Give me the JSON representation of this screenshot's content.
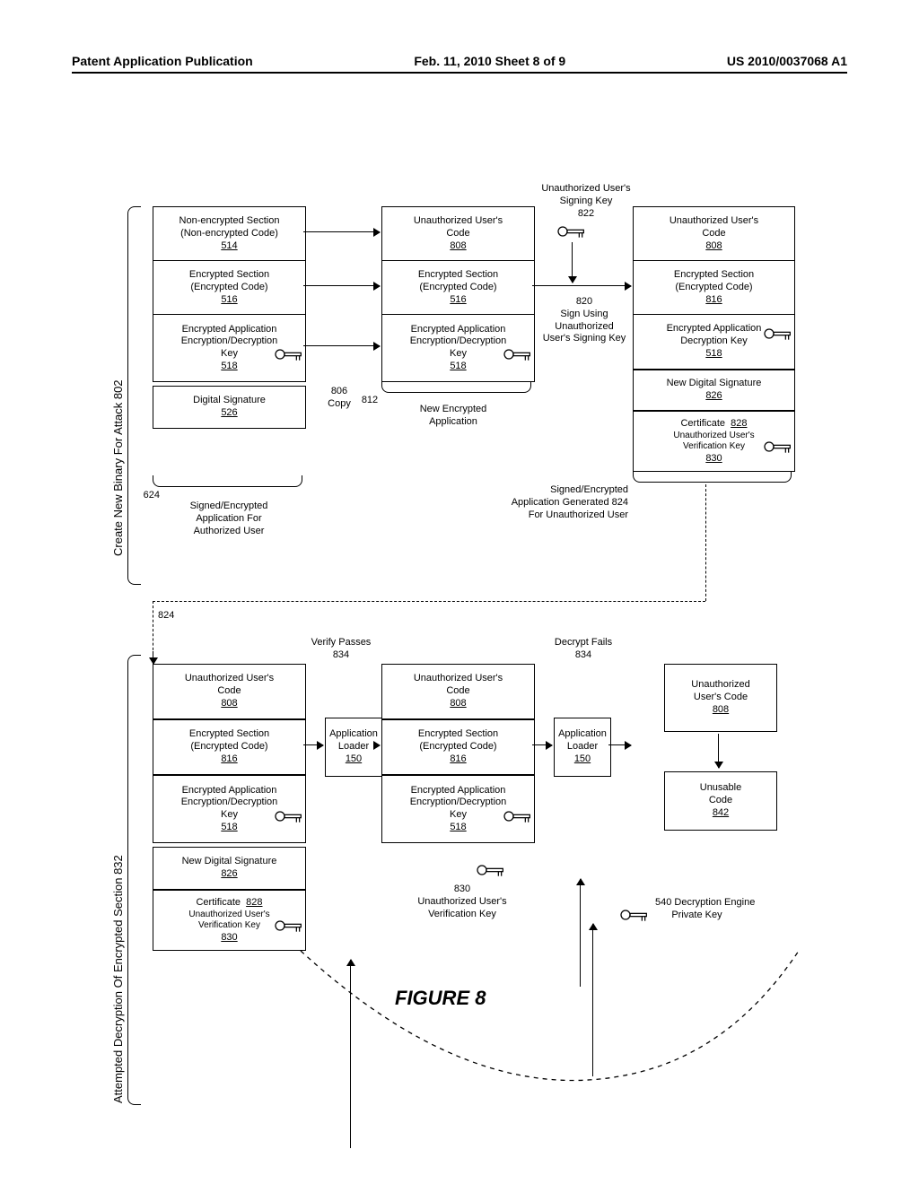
{
  "header": {
    "left": "Patent Application Publication",
    "center": "Feb. 11, 2010  Sheet 8 of 9",
    "right": "US 2010/0037068 A1"
  },
  "figure_label": "FIGURE 8",
  "sideLabels": {
    "top": "Create New Binary For Attack  802",
    "bot": "Attempted Decryption Of Encrypted Section  832"
  },
  "top": {
    "col1_r1_a": "Non-encrypted Section",
    "col1_r1_b": "(Non-encrypted Code)",
    "col1_r1_ref": "514",
    "col1_r2_a": "Encrypted Section",
    "col1_r2_b": "(Encrypted Code)",
    "col1_r2_ref": "516",
    "col1_r3_a": "Encrypted Application",
    "col1_r3_b": "Encryption/Decryption",
    "col1_r3_c": "Key",
    "col1_r3_ref": "518",
    "col1_r4_a": "Digital Signature",
    "col1_r4_ref": "526",
    "brace624_ref": "624",
    "brace624_text_a": "Signed/Encrypted",
    "brace624_text_b": "Application For",
    "brace624_text_c": "Authorized User",
    "copy_ref": "806",
    "copy_text": "Copy",
    "col2_r1_a": "Unauthorized User's",
    "col2_r1_b": "Code",
    "col2_r1_ref": "808",
    "col2_r2_a": "Encrypted Section",
    "col2_r2_b": "(Encrypted Code)",
    "col2_r2_ref": "516",
    "col2_r3_a": "Encrypted Application",
    "col2_r3_b": "Encryption/Decryption",
    "col2_r3_c": "Key",
    "col2_r3_ref": "518",
    "brace812_ref": "812",
    "brace812_text_a": "New Encrypted",
    "brace812_text_b": "Application",
    "arrow_key_top_a": "Unauthorized User's",
    "arrow_key_top_b": "Signing Key",
    "arrow_key_top_ref": "822",
    "arrow_key_mid_ref": "820",
    "arrow_key_mid_a": "Sign Using",
    "arrow_key_mid_b": "Unauthorized",
    "arrow_key_mid_c": "User's Signing Key",
    "col3_r1_a": "Unauthorized User's",
    "col3_r1_b": "Code",
    "col3_r1_ref": "808",
    "col3_r2_a": "Encrypted Section",
    "col3_r2_b": "(Encrypted Code)",
    "col3_r2_ref": "816",
    "col3_r3_a": "Encrypted Application",
    "col3_r3_b": "Decryption Key",
    "col3_r3_ref": "518",
    "col3_r4_a": "New Digital Signature",
    "col3_r4_ref": "826",
    "col3_r5_a": "Certificate",
    "col3_r5_ref": "828",
    "col3_r5_k_a": "Unauthorized User's",
    "col3_r5_k_b": "Verification Key",
    "col3_r5_k_ref": "830",
    "brace824_text_a": "Signed/Encrypted",
    "brace824_text_b": "Application Generated",
    "brace824_text_c": "For Unauthorized User",
    "brace824_ref": "824"
  },
  "bot": {
    "col1_b1_a": "Unauthorized User's",
    "col1_b1_b": "Code",
    "col1_b1_ref": "808",
    "col1_b2_a": "Encrypted Section",
    "col1_b2_b": "(Encrypted Code)",
    "col1_b2_ref": "816",
    "col1_b3_a": "Encrypted Application",
    "col1_b3_b": "Encryption/Decryption",
    "col1_b3_c": "Key",
    "col1_b3_ref": "518",
    "col1_b4_a": "New Digital Signature",
    "col1_b4_ref": "826",
    "col1_b5_a": "Certificate",
    "col1_b5_ref": "828",
    "col1_b5_k_a": "Unauthorized User's",
    "col1_b5_k_b": "Verification Key",
    "col1_b5_k_ref": "830",
    "verify_text": "Verify Passes",
    "verify_ref": "834",
    "loader_a": "Application",
    "loader_b": "Loader",
    "loader_ref": "150",
    "col2_b1_a": "Unauthorized User's",
    "col2_b1_b": "Code",
    "col2_b1_ref": "808",
    "col2_b2_a": "Encrypted Section",
    "col2_b2_b": "(Encrypted Code)",
    "col2_b2_ref": "816",
    "col2_b3_a": "Encrypted Application",
    "col2_b3_b": "Encryption/Decryption",
    "col2_b3_c": "Key",
    "col2_b3_ref": "518",
    "col2_key_a": "Unauthorized User's",
    "col2_key_b": "Verification Key",
    "col2_key_ref": "830",
    "decrypt_text": "Decrypt Fails",
    "decrypt_ref": "834",
    "col3_b1_a": "Unauthorized",
    "col3_b1_b": "User's Code",
    "col3_b1_ref": "808",
    "col3_b2_a": "Unusable",
    "col3_b2_b": "Code",
    "col3_b2_ref": "842",
    "engine_a": "Decryption Engine",
    "engine_b": "Private Key",
    "engine_ref": "540",
    "arrow_824_ref": "824"
  }
}
